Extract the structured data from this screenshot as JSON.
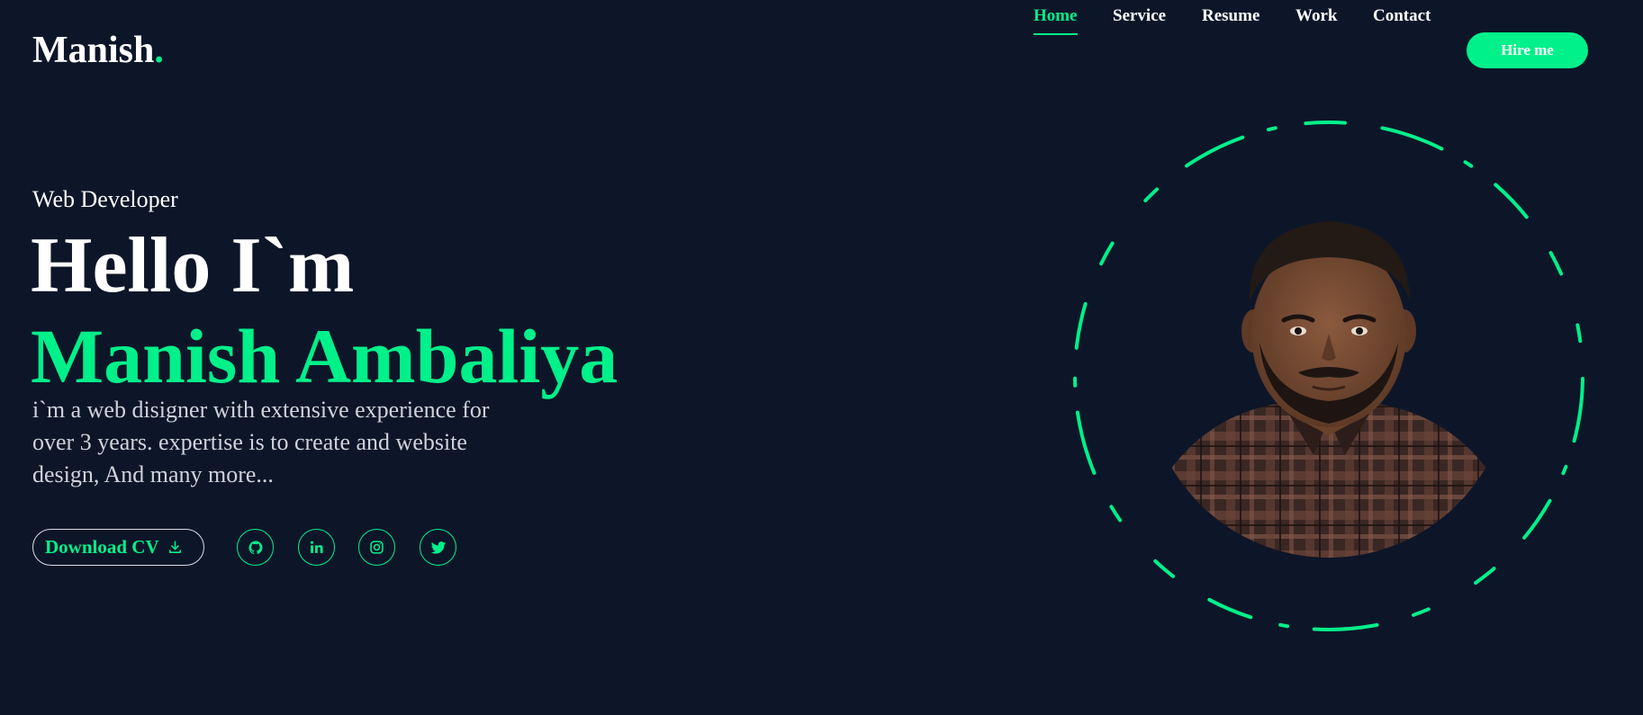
{
  "brand": {
    "name": "Manish",
    "dot": "."
  },
  "nav": {
    "items": [
      {
        "label": "Home",
        "active": true
      },
      {
        "label": "Service",
        "active": false
      },
      {
        "label": "Resume",
        "active": false
      },
      {
        "label": "Work",
        "active": false
      },
      {
        "label": "Contact",
        "active": false
      }
    ],
    "cta_label": "Hire me"
  },
  "hero": {
    "role": "Web Developer",
    "greeting": "Hello I`m",
    "name": "Manish Ambaliya",
    "intro": "i`m a web disigner with extensive experience for over 3 years. expertise is to create and website design, And many more...",
    "download_label": "Download CV",
    "socials": [
      {
        "icon": "github-icon"
      },
      {
        "icon": "linkedin-icon"
      },
      {
        "icon": "instagram-icon"
      },
      {
        "icon": "twitter-icon"
      }
    ]
  },
  "colors": {
    "background": "#0d1629",
    "accent": "#00f08a",
    "text": "#ffffff"
  }
}
